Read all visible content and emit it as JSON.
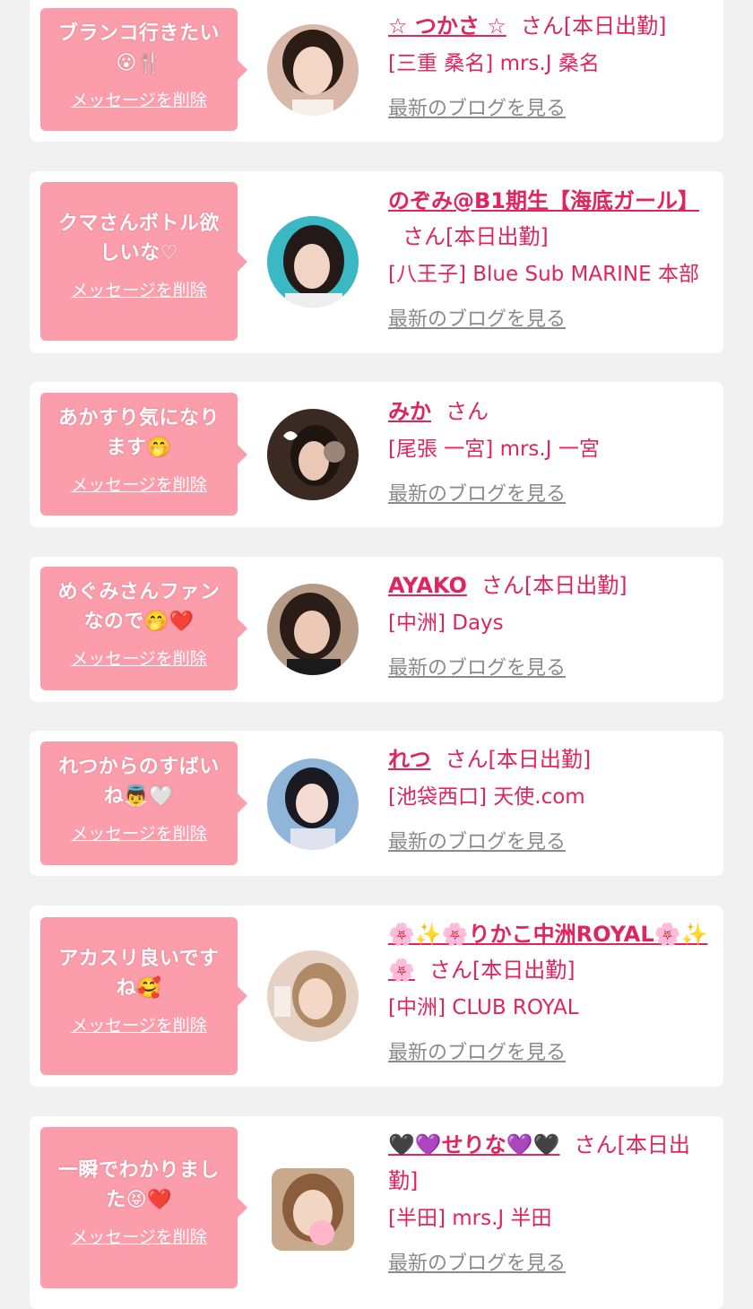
{
  "colors": {
    "background": "#f1f1f1",
    "card": "#ffffff",
    "bubble": "#fb9dab",
    "accent": "#e0245e",
    "muted": "#8a8a8a"
  },
  "cards": [
    {
      "message": "ブランコ行きたい😮🍴",
      "delete_label": "メッセージを削除",
      "name": "☆ つかさ ☆",
      "suffix": "さん[本日出勤]",
      "shop": "[三重 桑名] mrs.J 桑名",
      "blog_label": "最新のブログを見る",
      "avatar_icon": "avatar-photo"
    },
    {
      "message": "クマさんボトル欲しいな♡",
      "delete_label": "メッセージを削除",
      "name": "のぞみ@B1期生【海底ガール】",
      "suffix": "さん[本日出勤]",
      "shop": "[八王子] Blue Sub MARINE 本部",
      "blog_label": "最新のブログを見る",
      "avatar_icon": "avatar-photo"
    },
    {
      "message": "あかすり気になります🤭",
      "delete_label": "メッセージを削除",
      "name": "みか",
      "suffix": "さん",
      "shop": "[尾張 一宮] mrs.J 一宮",
      "blog_label": "最新のブログを見る",
      "avatar_icon": "avatar-photo"
    },
    {
      "message": "めぐみさんファンなので🤭❤️",
      "delete_label": "メッセージを削除",
      "name": "AYAKO",
      "suffix": "さん[本日出勤]",
      "shop": "[中洲] Days",
      "blog_label": "最新のブログを見る",
      "avatar_icon": "avatar-photo"
    },
    {
      "message": "れつからのすばいね👼🤍",
      "delete_label": "メッセージを削除",
      "name": "れつ",
      "suffix": "さん[本日出勤]",
      "shop": "[池袋西口] 天使.com",
      "blog_label": "最新のブログを見る",
      "avatar_icon": "avatar-photo"
    },
    {
      "message": "アカスリ良いですね🥰",
      "delete_label": "メッセージを削除",
      "name": "🌸✨🌸りかこ中洲ROYAL🌸✨🌸",
      "suffix": "さん[本日出勤]",
      "shop": "[中洲] CLUB ROYAL",
      "blog_label": "最新のブログを見る",
      "avatar_icon": "avatar-photo"
    },
    {
      "message": "一瞬でわかりました😝❤️",
      "delete_label": "メッセージを削除",
      "name": "🖤💜せりな💜🖤",
      "suffix": "さん[本日出勤]",
      "shop": "[半田] mrs.J 半田",
      "blog_label": "最新のブログを見る",
      "avatar_icon": "avatar-photo"
    }
  ]
}
